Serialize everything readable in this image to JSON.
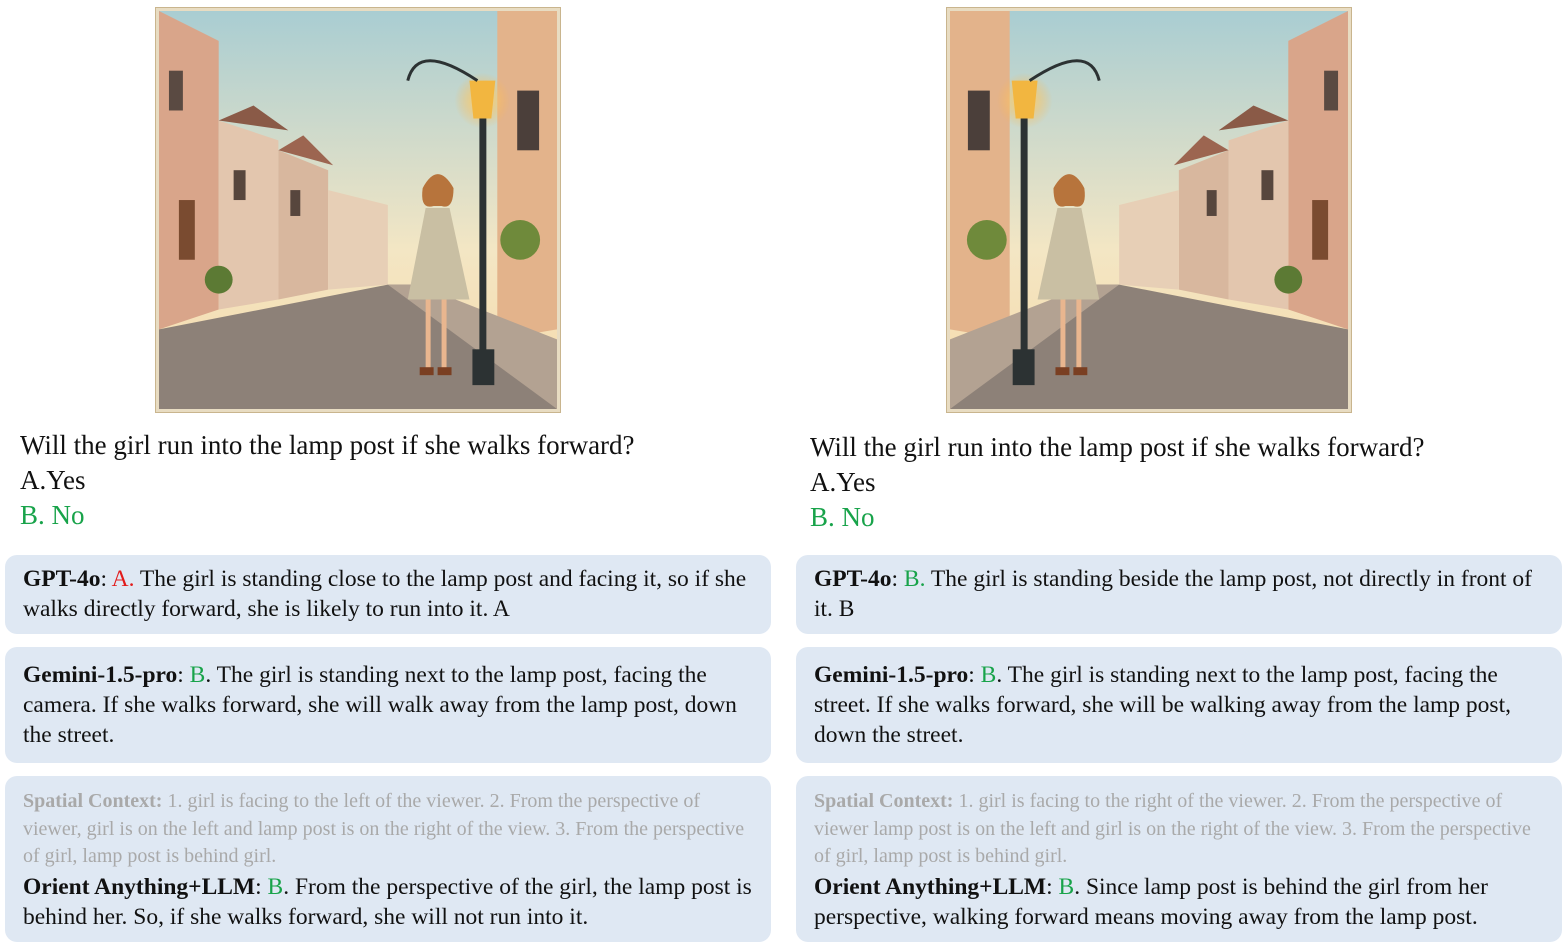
{
  "left": {
    "question": "Will the girl run into the lamp post if she walks forward?",
    "option_a": "A.Yes",
    "option_b": "B. No",
    "gpt": {
      "model": "GPT-4o",
      "sep": ": ",
      "answer": "A.",
      "text": " The girl is standing close to the lamp post and facing it, so if she walks directly forward, she is likely to run into it. A"
    },
    "gemini": {
      "model": "Gemini-1.5-pro",
      "sep": ": ",
      "answer": "B",
      "text": ". The girl is standing next to the lamp post, facing the camera. If she walks forward, she will walk away from the lamp post, down the street."
    },
    "orient": {
      "context_label": "Spatial Context:",
      "context_text": " 1. girl is facing to the left of the viewer. 2. From the perspective of viewer, girl is on the left and lamp post is on the right of the view. 3. From the perspective of girl, lamp post is behind girl.",
      "model": "Orient Anything+LLM",
      "sep": ": ",
      "answer": "B",
      "text": ". From the perspective of the girl, the lamp post is behind her. So, if she walks forward, she will not run into it."
    }
  },
  "right": {
    "question": "Will the girl run into the lamp post if she walks forward?",
    "option_a": "A.Yes",
    "option_b": "B. No",
    "gpt": {
      "model": "GPT-4o",
      "sep": ": ",
      "answer": "B.",
      "text": " The girl is standing beside the lamp post, not directly in front of it. B"
    },
    "gemini": {
      "model": "Gemini-1.5-pro",
      "sep": ": ",
      "answer": "B",
      "text": ". The girl is standing next to the lamp post, facing the street.  If she walks forward, she will be walking away from the lamp post, down the street."
    },
    "orient": {
      "context_label": "Spatial Context:",
      "context_text": " 1. girl is facing to the right of the viewer. 2. From the perspective of viewer lamp post is on the left and girl is on the right of the view. 3. From the perspective of girl, lamp post is behind girl.",
      "model": "Orient Anything+LLM",
      "sep": ": ",
      "answer": "B",
      "text": ". Since lamp post is behind the girl from her perspective, walking forward means moving away from the lamp post."
    }
  },
  "colors": {
    "correct": "#18a34a",
    "wrong": "#e21b1b",
    "card_bg": "#dfe8f3",
    "context_gray": "#a9a9a9"
  }
}
